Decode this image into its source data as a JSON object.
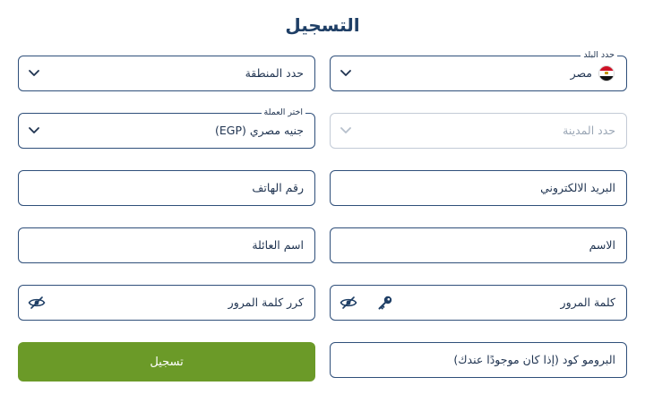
{
  "title": "التسجيل",
  "country": {
    "label": "حدد البلد",
    "value": "مصر",
    "flag": "egypt-flag"
  },
  "region": {
    "placeholder": "حدد المنطقة"
  },
  "city": {
    "placeholder": "حدد المدينة"
  },
  "currency": {
    "label": "اختر العملة",
    "value": "جنيه مصري (EGP)"
  },
  "email": {
    "placeholder": "البريد الالكتروني"
  },
  "phone": {
    "placeholder": "رقم الهاتف"
  },
  "first_name": {
    "placeholder": "الاسم"
  },
  "last_name": {
    "placeholder": "اسم العائلة"
  },
  "password": {
    "placeholder": "كلمة المرور"
  },
  "confirm_password": {
    "placeholder": "كرر كلمة المرور"
  },
  "promo": {
    "placeholder": "البرومو كود (إذا كان موجودًا عندك)"
  },
  "submit": {
    "label": "تسجيل"
  },
  "colors": {
    "primary_button": "#6b9a28",
    "border": "#2f4f7a",
    "disabled_border": "#c3cbd6",
    "title": "#1f3f66"
  }
}
